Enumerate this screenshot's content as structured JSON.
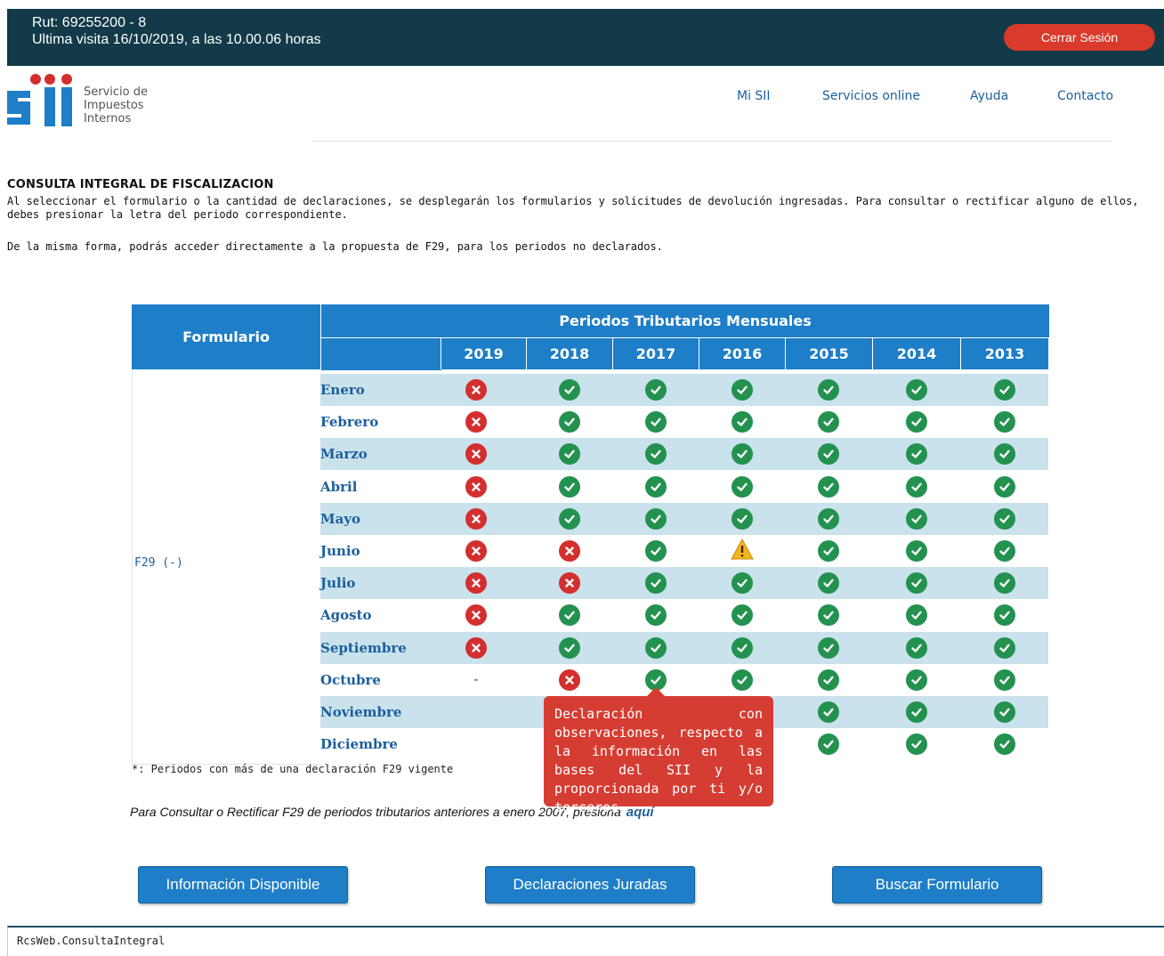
{
  "header": {
    "rut": "Rut: 69255200 - 8",
    "last_visit": "Ultima visita 16/10/2019, a las 10.00.06 horas",
    "logout_label": "Cerrar Sesión"
  },
  "logo": {
    "text_line1": "Servicio de",
    "text_line2": "Impuestos",
    "text_line3": "Internos",
    "colors": {
      "blue": "#1e7ec7",
      "red": "#d32f2f"
    }
  },
  "nav": {
    "items": [
      {
        "label": "Mi SII"
      },
      {
        "label": "Servicios online"
      },
      {
        "label": "Ayuda"
      },
      {
        "label": "Contacto"
      }
    ]
  },
  "page": {
    "title": "CONSULTA INTEGRAL DE FISCALIZACION",
    "description": "Al seleccionar el formulario o la cantidad de declaraciones, se desplegarán los formularios y solicitudes de devolución ingresadas. Para consultar o rectificar alguno de ellos, debes presionar la letra del periodo correspondiente.",
    "description2": "De la misma forma, podrás acceder directamente a la propuesta de F29, para los periodos no declarados."
  },
  "table": {
    "form_header": "Formulario",
    "periods_header": "Periodos Tributarios Mensuales",
    "years": [
      "2019",
      "2018",
      "2017",
      "2016",
      "2015",
      "2014",
      "2013"
    ],
    "form_label": "F29 (-)",
    "rows": [
      {
        "month": "Enero",
        "status": [
          "err",
          "ok",
          "ok",
          "ok",
          "ok",
          "ok",
          "ok"
        ]
      },
      {
        "month": "Febrero",
        "status": [
          "err",
          "ok",
          "ok",
          "ok",
          "ok",
          "ok",
          "ok"
        ]
      },
      {
        "month": "Marzo",
        "status": [
          "err",
          "ok",
          "ok",
          "ok",
          "ok",
          "ok",
          "ok"
        ]
      },
      {
        "month": "Abril",
        "status": [
          "err",
          "ok",
          "ok",
          "ok",
          "ok",
          "ok",
          "ok"
        ]
      },
      {
        "month": "Mayo",
        "status": [
          "err",
          "ok",
          "ok",
          "ok",
          "ok",
          "ok",
          "ok"
        ]
      },
      {
        "month": "Junio",
        "status": [
          "err",
          "err",
          "ok",
          "warn",
          "ok",
          "ok",
          "ok"
        ]
      },
      {
        "month": "Julio",
        "status": [
          "err",
          "err",
          "ok",
          "ok",
          "ok",
          "ok",
          "ok"
        ]
      },
      {
        "month": "Agosto",
        "status": [
          "err",
          "ok",
          "ok",
          "ok",
          "ok",
          "ok",
          "ok"
        ]
      },
      {
        "month": "Septiembre",
        "status": [
          "err",
          "ok",
          "ok",
          "ok",
          "ok",
          "ok",
          "ok"
        ]
      },
      {
        "month": "Octubre",
        "status": [
          "dash",
          "err",
          "ok",
          "ok",
          "ok",
          "ok",
          "ok"
        ]
      },
      {
        "month": "Noviembre",
        "status": [
          "",
          "",
          "",
          "",
          "ok",
          "ok",
          "ok"
        ]
      },
      {
        "month": "Diciembre",
        "status": [
          "",
          "",
          "",
          "",
          "ok",
          "ok",
          "ok"
        ]
      }
    ],
    "dash_symbol": "-",
    "status_colors": {
      "ok": "#24924f",
      "err": "#d32f2f",
      "warn": "#f2b51c"
    }
  },
  "tooltip": {
    "text": "Declaración con observaciones, respecto a la información en las bases del SII y la proporcionada por ti y/o terceros."
  },
  "notes": {
    "footnote": "*: Periodos con más de una declaración F29 vigente",
    "older_periods": "Para Consultar o Rectificar F29 de periodos tributarios anteriores a enero 2007, presiona",
    "older_link": "aquí"
  },
  "buttons": {
    "info": "Información Disponible",
    "declarations": "Declaraciones Juradas",
    "search": "Buscar Formulario"
  },
  "footer": {
    "app_name": "RcsWeb.ConsultaIntegral"
  }
}
